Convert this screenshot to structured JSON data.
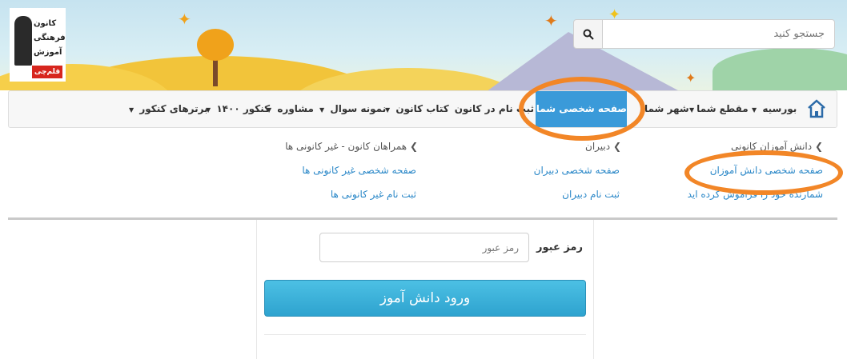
{
  "logo": {
    "lines": [
      "کانون",
      "فرهنگی",
      "آموزش"
    ],
    "badge": "قلم‌چی"
  },
  "search": {
    "placeholder": "جستجو کنید"
  },
  "nav": {
    "home_icon": "home-icon",
    "items": [
      {
        "label": "بورسیه"
      },
      {
        "label": "مقطع شما"
      },
      {
        "label": "شهر شما"
      },
      {
        "label": "صفحه شخصی شما"
      },
      {
        "label": "ثبت نام در کانون"
      },
      {
        "label": "کتاب کانون"
      },
      {
        "label": "نمونه سوال"
      },
      {
        "label": "مشاوره"
      },
      {
        "label": "کنکور ۱۴۰۰"
      },
      {
        "label": "برترهای کنکور"
      }
    ]
  },
  "dropdown": {
    "col1": {
      "title": "دانش آموزان کانونی",
      "links": [
        "صفحه شخصی دانش آموزان",
        "شمارنده خود را فراموش کرده اید"
      ]
    },
    "col2": {
      "title": "دبیران",
      "links": [
        "صفحه شخصی دبیران",
        "ثبت نام دبیران"
      ]
    },
    "col3": {
      "title": "همراهان کانون - غیر کانونی ها",
      "links": [
        "صفحه شخصی غیر کانونی ها",
        "ثبت نام غیر کانونی ها"
      ]
    }
  },
  "login": {
    "password_label": "رمز عبور",
    "password_placeholder": "رمز عبور",
    "submit_label": "ورود دانش آموز"
  },
  "colors": {
    "accent": "#3a9ad9",
    "link": "#2b88c8",
    "annotation": "#f28627"
  }
}
